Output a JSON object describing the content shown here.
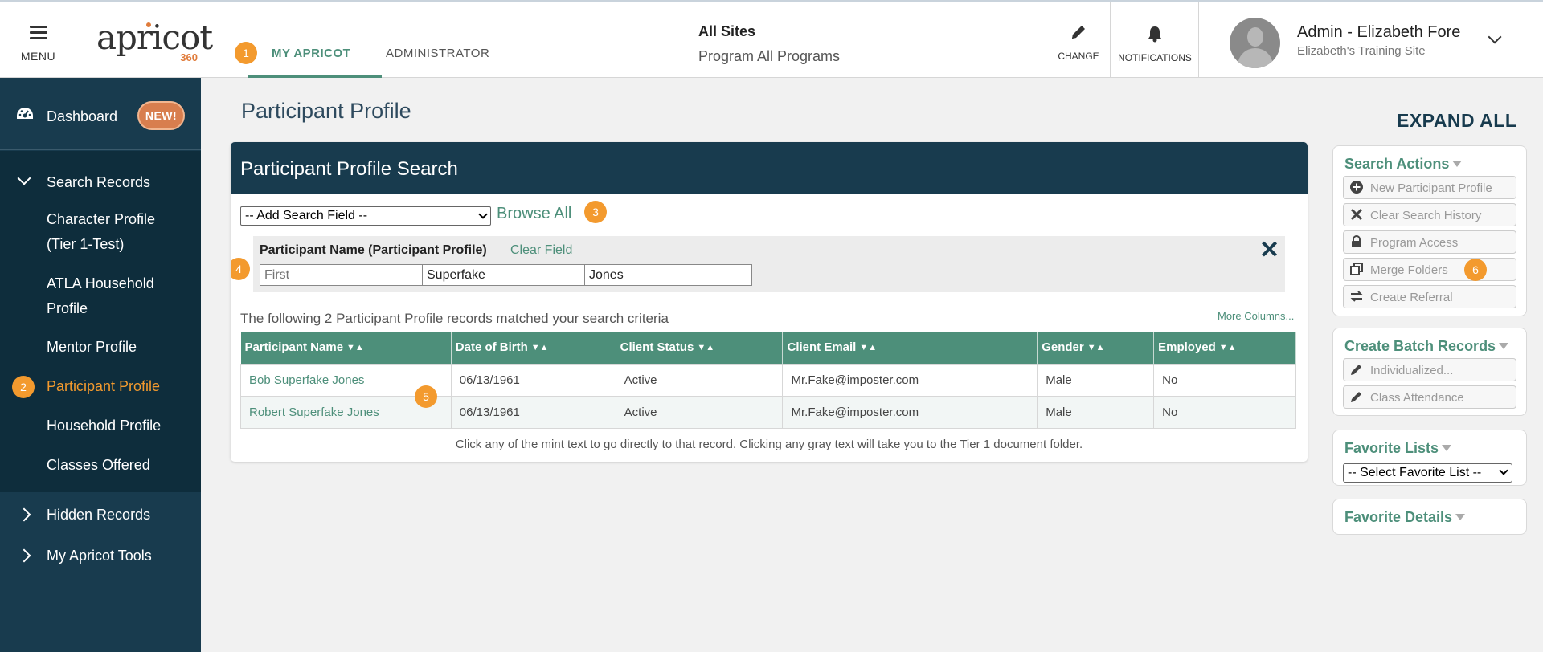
{
  "header": {
    "menu_label": "MENU",
    "logo_text": "apricot",
    "logo_sub": "360",
    "tab_my_label": "MY APRICOT",
    "tab_my_badge": "1",
    "tab_admin_label": "ADMINISTRATOR",
    "sites_title": "All Sites",
    "sites_program": "Program All Programs",
    "change_label": "CHANGE",
    "notifications_label": "NOTIFICATIONS",
    "user_name": "Admin - Elizabeth Fore",
    "user_site": "Elizabeth's Training Site"
  },
  "sidebar": {
    "dashboard_label": "Dashboard",
    "new_badge": "NEW!",
    "search_records_label": "Search Records",
    "items": [
      {
        "label": "Character Profile (Tier 1-Test)"
      },
      {
        "label": "ATLA Household Profile"
      },
      {
        "label": "Mentor Profile"
      },
      {
        "label": "Participant Profile",
        "badge": "2",
        "active": true
      },
      {
        "label": "Household Profile"
      },
      {
        "label": "Classes Offered"
      }
    ],
    "hidden_records_label": "Hidden Records",
    "tools_label": "My Apricot Tools"
  },
  "main": {
    "page_title": "Participant Profile",
    "panel_title": "Participant Profile Search",
    "add_search_field": "-- Add Search Field --",
    "browse_all": "Browse All",
    "browse_badge": "3",
    "field_title": "Participant Name (Participant Profile)",
    "clear_field": "Clear Field",
    "field_badge": "4",
    "first_placeholder": "First",
    "middle_value": "Superfake",
    "last_value": "Jones",
    "results_text": "The following 2 Participant Profile records matched your search criteria",
    "more_columns": "More Columns...",
    "columns": [
      "Participant Name",
      "Date of Birth",
      "Client Status",
      "Client Email",
      "Gender",
      "Employed"
    ],
    "rows": [
      {
        "name": "Bob Superfake Jones",
        "dob": "06/13/1961",
        "status": "Active",
        "email": "Mr.Fake@imposter.com",
        "gender": "Male",
        "employed": "No"
      },
      {
        "name": "Robert Superfake Jones",
        "dob": "06/13/1961",
        "status": "Active",
        "email": "Mr.Fake@imposter.com",
        "gender": "Male",
        "employed": "No"
      }
    ],
    "row_badge": "5",
    "footnote": "Click any of the mint text to go directly to that record. Clicking any gray text will take you to the Tier 1 document folder."
  },
  "right": {
    "expand_all": "EXPAND ALL",
    "search_actions_title": "Search Actions",
    "search_actions": [
      {
        "label": "New Participant Profile",
        "icon": "plus-circle-icon"
      },
      {
        "label": "Clear Search History",
        "icon": "x-icon"
      },
      {
        "label": "Program Access",
        "icon": "lock-icon"
      },
      {
        "label": "Merge Folders",
        "icon": "copy-icon",
        "badge": "6"
      },
      {
        "label": "Create Referral",
        "icon": "swap-icon"
      }
    ],
    "batch_title": "Create Batch Records",
    "batch_actions": [
      {
        "label": "Individualized...",
        "icon": "pencil-icon"
      },
      {
        "label": "Class Attendance",
        "icon": "pencil-icon"
      }
    ],
    "favorite_lists_title": "Favorite Lists",
    "favorite_select": "-- Select Favorite List --",
    "favorite_details_title": "Favorite Details"
  },
  "colors": {
    "navy": "#183b4e",
    "mint": "#4d8f7a",
    "orange": "#f39a2e"
  }
}
